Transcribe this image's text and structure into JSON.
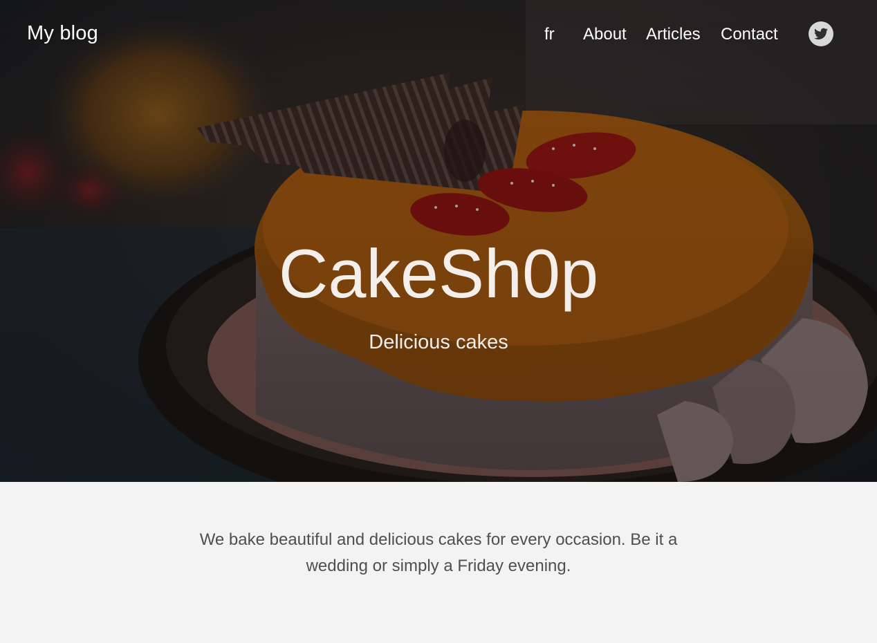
{
  "site": {
    "brand": "My blog"
  },
  "nav": {
    "items": [
      {
        "key": "lang",
        "label": "fr"
      },
      {
        "key": "about",
        "label": "About"
      },
      {
        "key": "articles",
        "label": "Articles"
      },
      {
        "key": "contact",
        "label": "Contact"
      }
    ],
    "social_icon": "twitter-icon"
  },
  "hero": {
    "title": "CakeSh0p",
    "subtitle": "Delicious cakes",
    "image": "cake-with-caramel-glaze-strawberries-chocolate"
  },
  "intro": {
    "text": "We bake beautiful and delicious cakes for every occasion. Be it a wedding or simply a Friday evening."
  },
  "colors": {
    "page_background": "#f3f3f3",
    "hero_overlay": "#1c1e22",
    "text_light": "#ffffff",
    "text_body": "#4f4f4f",
    "caramel": "#a25710"
  }
}
